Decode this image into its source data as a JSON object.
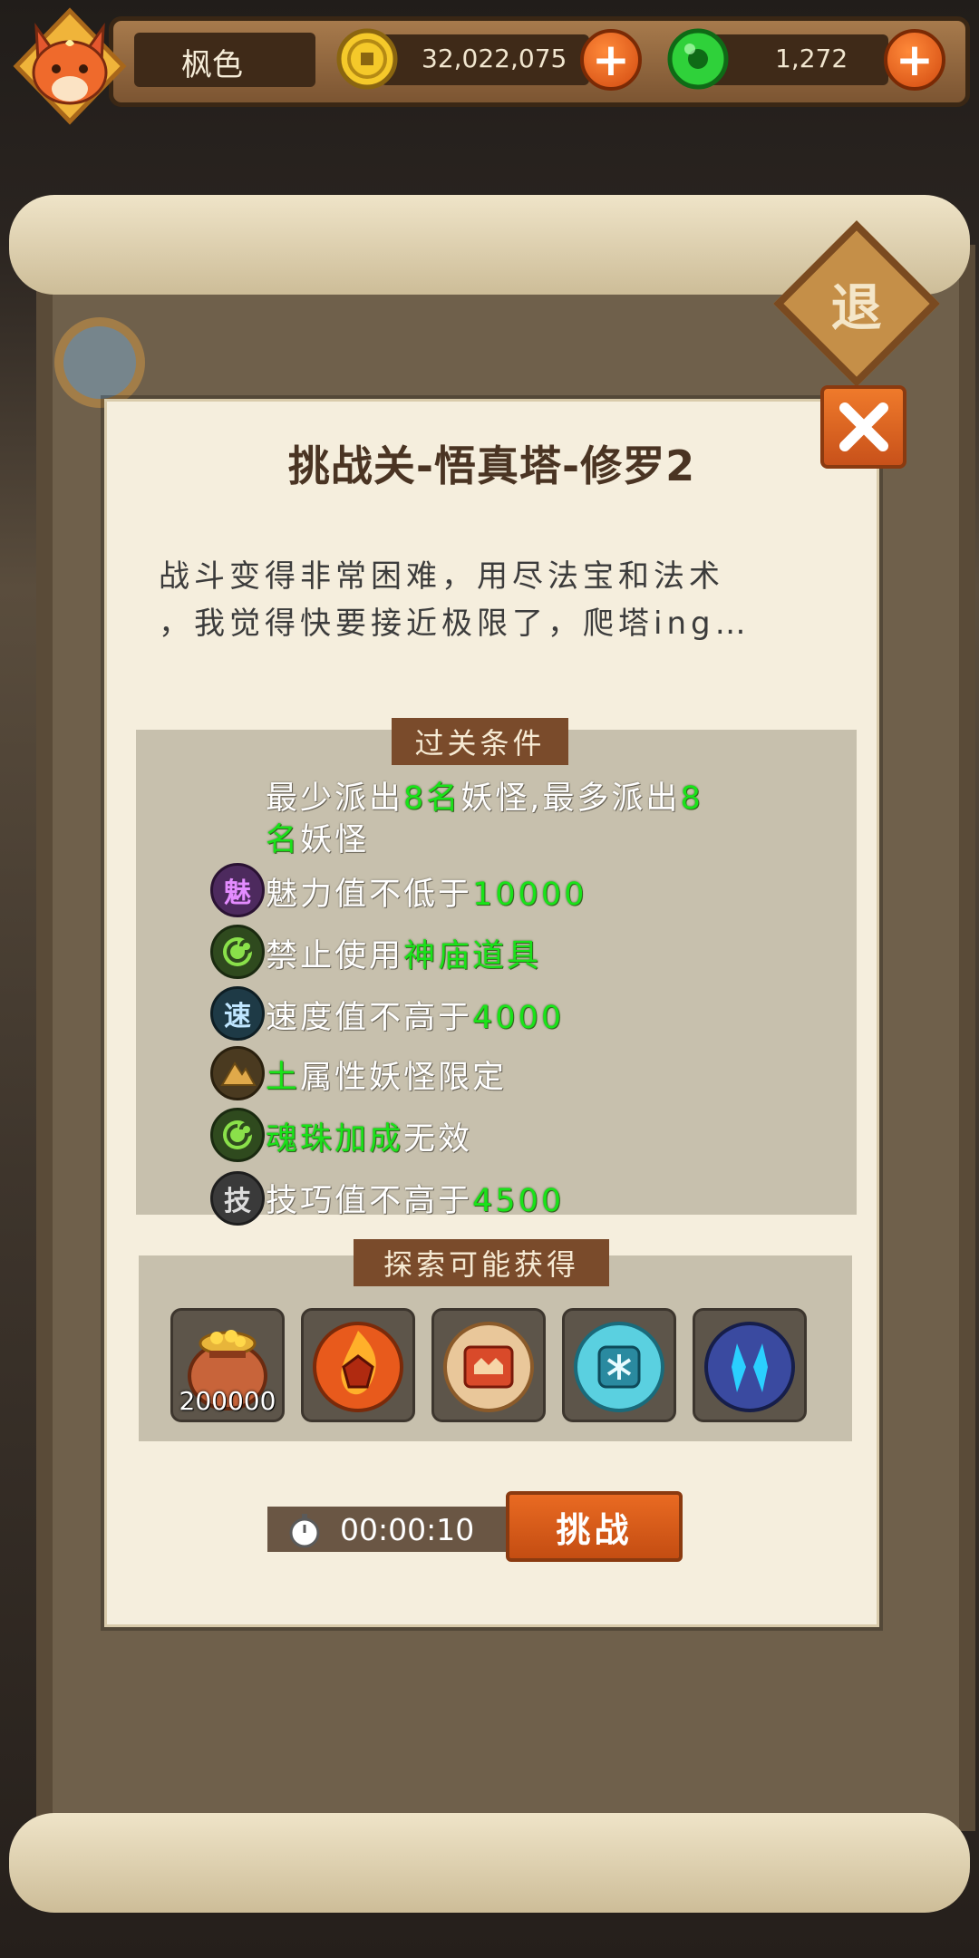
{
  "header": {
    "player_name": "枫色",
    "gold_amount": "32,022,075",
    "jade_amount": "1,272"
  },
  "background": {
    "retreat_label": "退"
  },
  "dialog": {
    "title": "挑战关-悟真塔-修罗2",
    "description_line1": "战斗变得非常困难，用尽法宝和法术",
    "description_line2": "，我觉得快要接近极限了，爬塔ing…",
    "conditions_header": "过关条件",
    "conditions": {
      "dispatch_a": "最少派出",
      "dispatch_min": "8名",
      "dispatch_b": "妖怪,最多派出",
      "dispatch_max_part1": "8",
      "dispatch_max_part2": "名",
      "dispatch_c": "妖怪",
      "charm_icon": "魅",
      "charm_text": "魅力值不低于",
      "charm_value": "10000",
      "ban_text": "禁止使用",
      "ban_value": "神庙道具",
      "speed_icon": "速",
      "speed_text": "速度值不高于",
      "speed_value": "4000",
      "element_value": "土",
      "element_text": "属性妖怪限定",
      "orb_value": "魂珠加成",
      "orb_text": "无效",
      "skill_icon": "技",
      "skill_text": "技巧值不高于",
      "skill_value": "4500"
    },
    "rewards_header": "探索可能获得",
    "rewards": [
      {
        "icon": "gold-bag-icon",
        "quantity": "200000"
      },
      {
        "icon": "fire-orb-icon"
      },
      {
        "icon": "strength-orb-icon"
      },
      {
        "icon": "ice-orb-icon"
      },
      {
        "icon": "shadow-orb-icon"
      }
    ],
    "timer": "00:00:10",
    "challenge_label": "挑战"
  },
  "colors": {
    "highlight_green": "#19e319",
    "button_orange": "#e0601c",
    "tag_brown": "#7a4b2b"
  }
}
